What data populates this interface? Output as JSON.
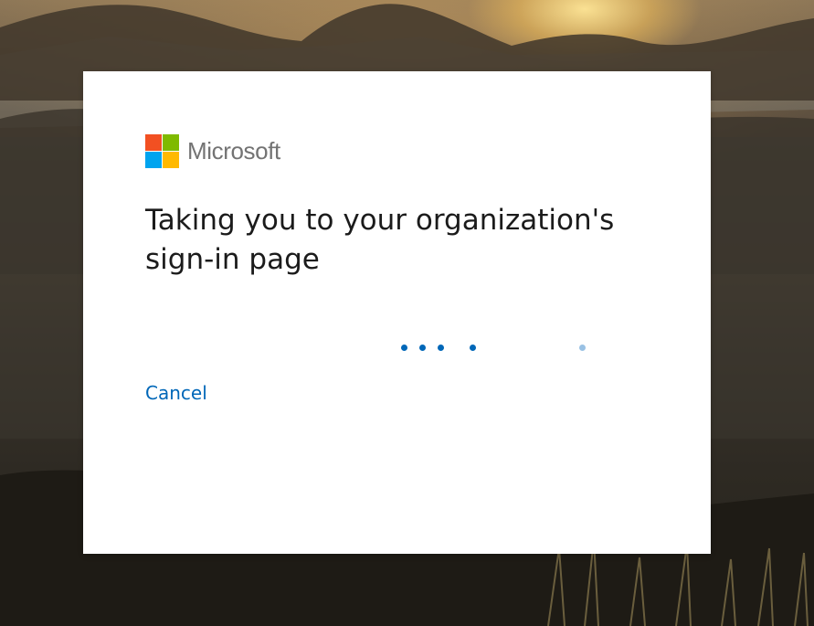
{
  "brand": {
    "name": "Microsoft",
    "logo_colors": [
      "#f25022",
      "#7fba00",
      "#00a4ef",
      "#ffb900"
    ]
  },
  "dialog": {
    "title": "Taking you to your organization's sign-in page",
    "cancel_label": "Cancel"
  },
  "progress_indicator": {
    "dots": [
      {
        "color": "#0067b8"
      },
      {
        "color": "#0067b8"
      },
      {
        "color": "#0067b8"
      },
      {
        "color": "#0067b8"
      },
      {
        "color": "#99c1e4"
      }
    ]
  },
  "colors": {
    "accent": "#0067b8",
    "title_text": "#1b1b1b",
    "card_background": "#ffffff"
  }
}
